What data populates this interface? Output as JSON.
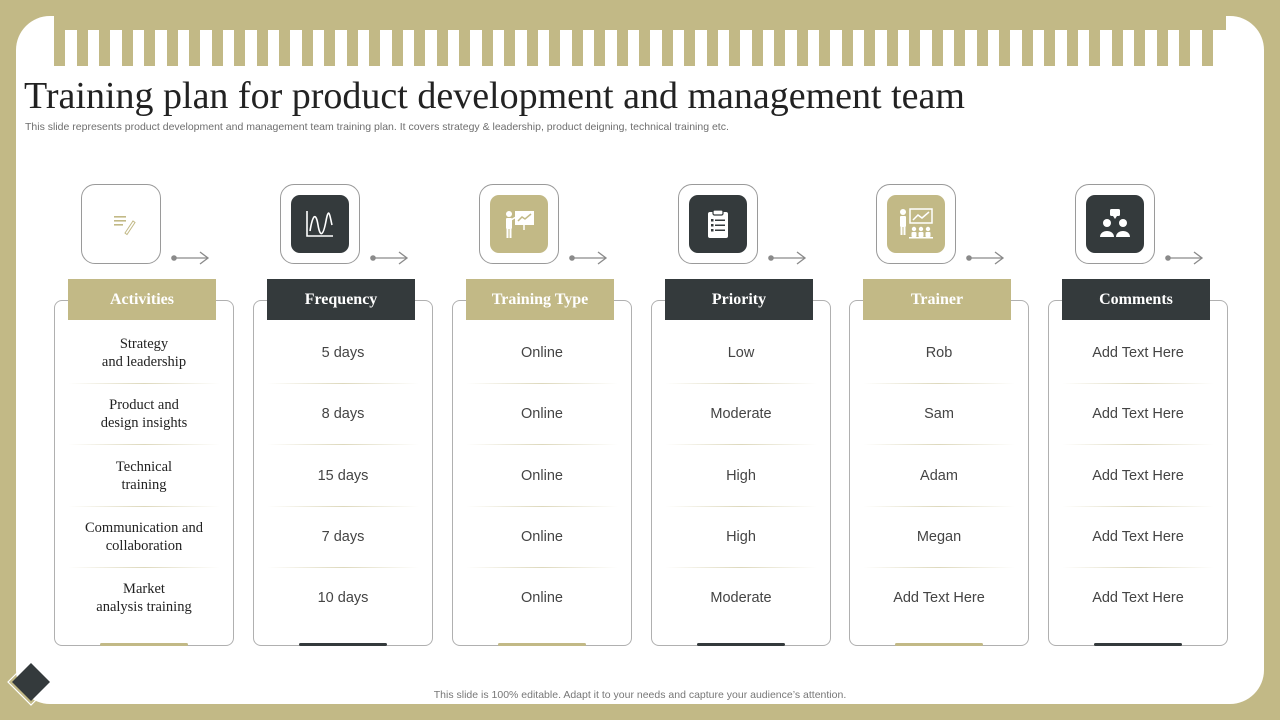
{
  "title": "Training plan for product development and management team",
  "subtitle": "This slide represents product development and management  team training plan. It covers strategy & leadership, product deigning, technical training etc.",
  "footer": "This slide is 100% editable.  Adapt it to your needs and capture your audience’s attention.",
  "colors": {
    "accent": "#c2b986",
    "dark": "#343a3c",
    "background": "#ffffff"
  },
  "columns": [
    {
      "header": "Activities",
      "theme": "gold",
      "icon": "document-icon",
      "rows": [
        "Strategy\nand leadership",
        "Product and\ndesign insights",
        "Technical\ntraining",
        "Communication  and\ncollaboration",
        "Market\nanalysis training"
      ]
    },
    {
      "header": "Frequency",
      "theme": "dark",
      "icon": "line-chart-icon",
      "rows": [
        "5 days",
        "8 days",
        "15 days",
        "7 days",
        "10 days"
      ]
    },
    {
      "header": "Training Type",
      "theme": "gold",
      "icon": "presentation-board-icon",
      "rows": [
        "Online",
        "Online",
        "Online",
        "Online",
        "Online"
      ]
    },
    {
      "header": "Priority",
      "theme": "dark",
      "icon": "clipboard-checklist-icon",
      "rows": [
        "Low",
        "Moderate",
        "High",
        "High",
        "Moderate"
      ]
    },
    {
      "header": "Trainer",
      "theme": "gold",
      "icon": "trainer-audience-icon",
      "rows": [
        "Rob",
        "Sam",
        "Adam",
        "Megan",
        "Add Text Here"
      ]
    },
    {
      "header": "Comments",
      "theme": "dark",
      "icon": "discussion-people-icon",
      "rows": [
        "Add Text Here",
        "Add Text Here",
        "Add Text Here",
        "Add Text Here",
        "Add Text Here"
      ]
    }
  ]
}
